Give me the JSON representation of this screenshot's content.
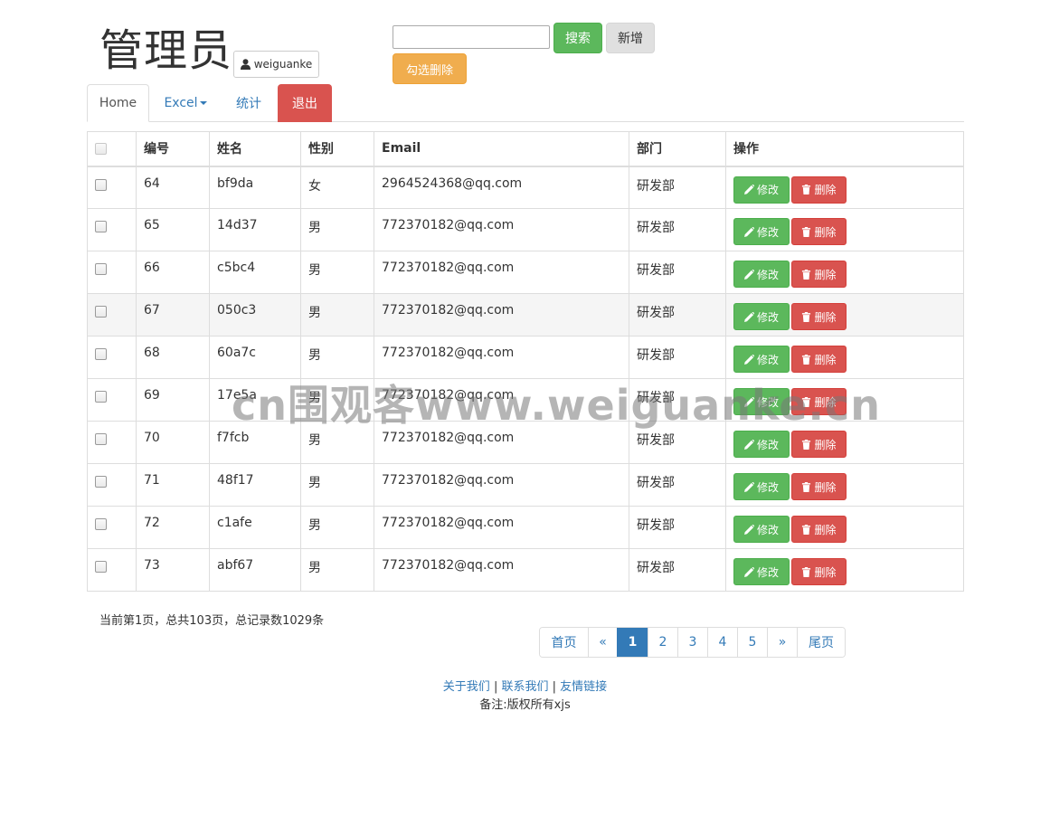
{
  "header": {
    "title": "管理员",
    "username": "weiguanke",
    "user_icon": "user-icon"
  },
  "toolbar": {
    "search_placeholder": "",
    "search_value": "",
    "search_label": "搜索",
    "add_label": "新增",
    "batch_delete_label": "勾选删除"
  },
  "nav": {
    "home": "Home",
    "excel": "Excel",
    "stats": "统计",
    "logout": "退出"
  },
  "table": {
    "headers": [
      "编号",
      "姓名",
      "性别",
      "Email",
      "部门",
      "操作"
    ],
    "edit_label": "修改",
    "delete_label": "删除",
    "rows": [
      {
        "id": "64",
        "name": "bf9da",
        "gender": "女",
        "email": "2964524368@qq.com",
        "dept": "研发部"
      },
      {
        "id": "65",
        "name": "14d37",
        "gender": "男",
        "email": "772370182@qq.com",
        "dept": "研发部"
      },
      {
        "id": "66",
        "name": "c5bc4",
        "gender": "男",
        "email": "772370182@qq.com",
        "dept": "研发部"
      },
      {
        "id": "67",
        "name": "050c3",
        "gender": "男",
        "email": "772370182@qq.com",
        "dept": "研发部"
      },
      {
        "id": "68",
        "name": "60a7c",
        "gender": "男",
        "email": "772370182@qq.com",
        "dept": "研发部"
      },
      {
        "id": "69",
        "name": "17e5a",
        "gender": "男",
        "email": "772370182@qq.com",
        "dept": "研发部"
      },
      {
        "id": "70",
        "name": "f7fcb",
        "gender": "男",
        "email": "772370182@qq.com",
        "dept": "研发部"
      },
      {
        "id": "71",
        "name": "48f17",
        "gender": "男",
        "email": "772370182@qq.com",
        "dept": "研发部"
      },
      {
        "id": "72",
        "name": "c1afe",
        "gender": "男",
        "email": "772370182@qq.com",
        "dept": "研发部"
      },
      {
        "id": "73",
        "name": "abf67",
        "gender": "男",
        "email": "772370182@qq.com",
        "dept": "研发部"
      }
    ]
  },
  "pagination": {
    "info": "当前第1页，总共103页，总记录数1029条",
    "items": [
      "首页",
      "«",
      "1",
      "2",
      "3",
      "4",
      "5",
      "»",
      "尾页"
    ],
    "active": "1"
  },
  "footer": {
    "about": "关于我们",
    "contact": "联系我们",
    "links": "友情链接",
    "separator": "|",
    "note": "备注:版权所有xjs"
  },
  "watermark": "cn围观客www.weiguanke.cn",
  "colors": {
    "primary": "#337ab7",
    "success": "#5cb85c",
    "danger": "#d9534f",
    "warning": "#f0ad4e"
  }
}
